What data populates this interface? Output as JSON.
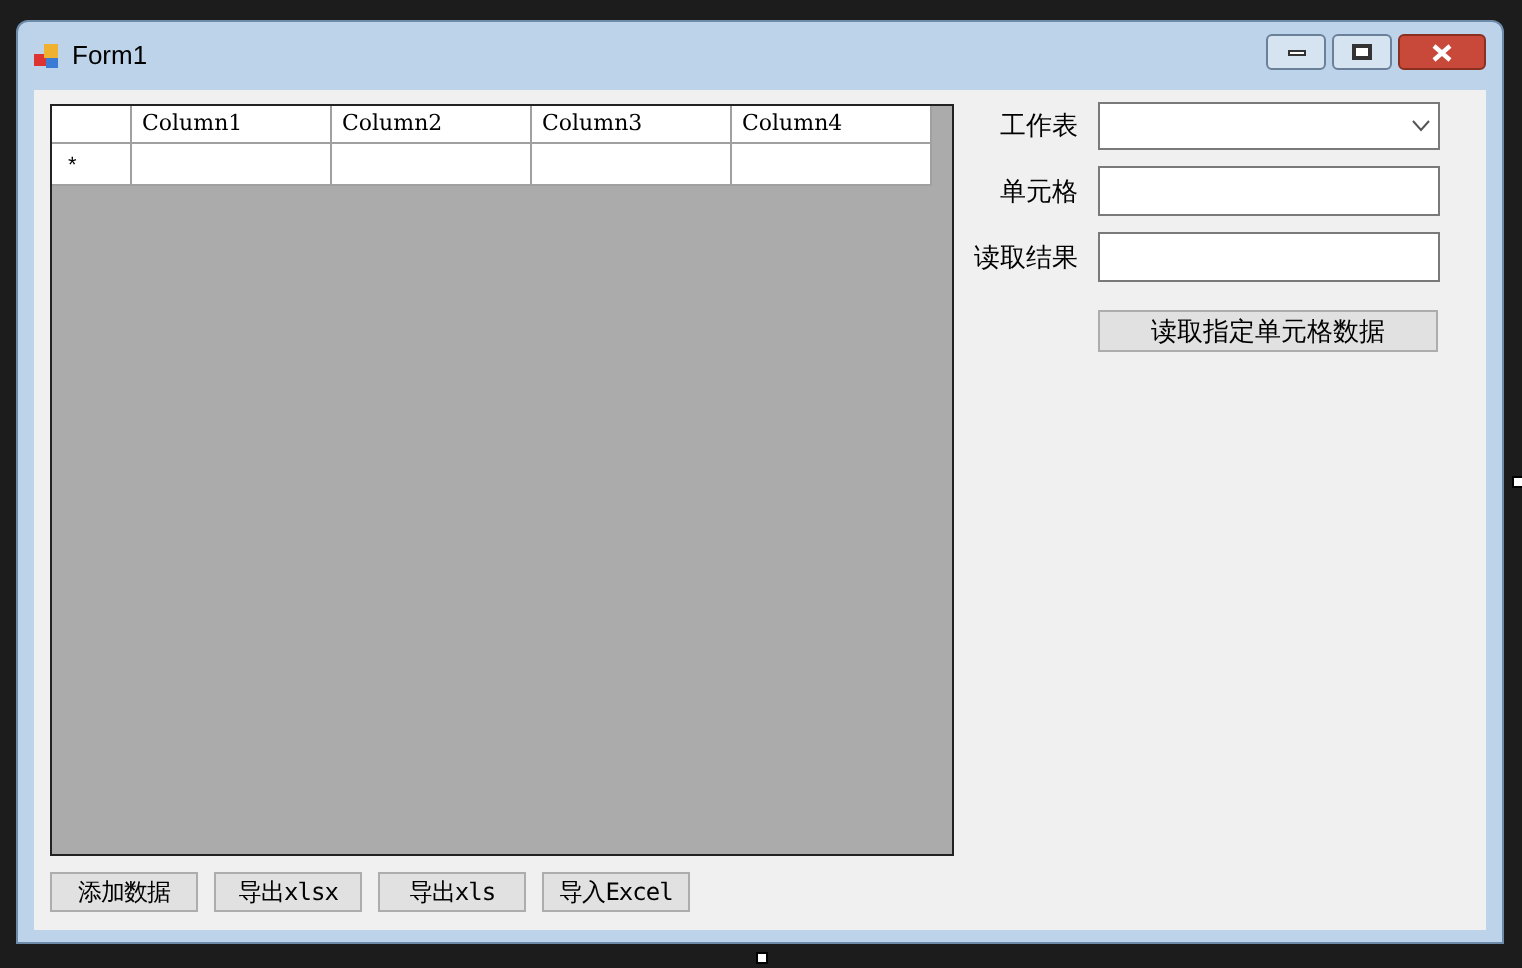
{
  "window": {
    "title": "Form1"
  },
  "grid": {
    "columns": [
      "Column1",
      "Column2",
      "Column3",
      "Column4"
    ],
    "new_row_marker": "*"
  },
  "form": {
    "fields": [
      {
        "kind": "dropdown",
        "label": "工作表"
      },
      {
        "kind": "text",
        "label": "单元格"
      },
      {
        "kind": "text",
        "label": "读取结果"
      }
    ],
    "read_button": "读取指定单元格数据"
  },
  "buttons": [
    "添加数据",
    "导出xlsx",
    "导出xls",
    "导入Excel"
  ]
}
